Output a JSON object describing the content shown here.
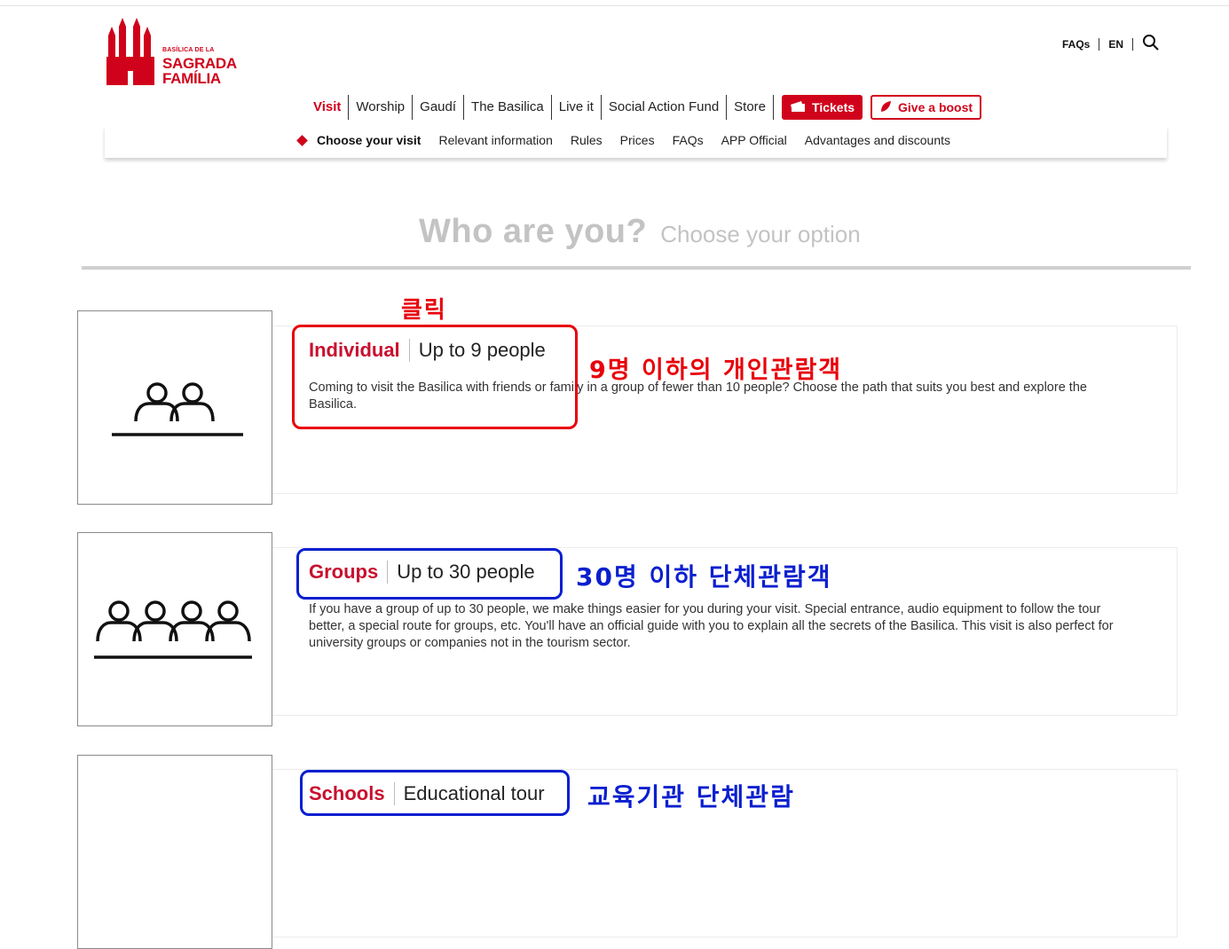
{
  "logo": {
    "line1": "BASÍLICA DE LA",
    "line2": "SAGRADA",
    "line3": "FAMÍLIA"
  },
  "util": {
    "faqs": "FAQs",
    "lang": "EN",
    "search_icon": "search-icon"
  },
  "nav": {
    "items": [
      "Visit",
      "Worship",
      "Gaudí",
      "The Basilica",
      "Live it",
      "Social Action Fund",
      "Store"
    ],
    "tickets": "Tickets",
    "boost": "Give a boost"
  },
  "subnav": {
    "active": "Choose your visit",
    "items": [
      "Relevant information",
      "Rules",
      "Prices",
      "FAQs",
      "APP Official",
      "Advantages and discounts"
    ]
  },
  "heading": {
    "main": "Who are you?",
    "sub": "Choose your option"
  },
  "cards": [
    {
      "name": "Individual",
      "desc": "Up to 9 people",
      "text": "Coming to visit the Basilica with friends or family in a group of fewer than 10 people? Choose the path that suits you best and explore the Basilica."
    },
    {
      "name": "Groups",
      "desc": "Up to 30 people",
      "text": "If you have a group of up to 30 people, we make things easier for you during your visit. Special entrance, audio equipment to follow the tour better, a special route for groups, etc. You'll have an official guide with you to explain all the secrets of the Basilica. This visit is also perfect for university groups or companies not in the tourism sector."
    },
    {
      "name": "Schools",
      "desc": "Educational tour",
      "text": ""
    }
  ],
  "annotations": {
    "click": "클릭",
    "individual": "9명 이하의 개인관람객",
    "groups": "30명 이하 단체관람객",
    "schools": "교육기관 단체관람"
  },
  "colors": {
    "brand": "#d0021b",
    "annotation_red": "#e8000a",
    "annotation_blue": "#0a1fcf"
  }
}
